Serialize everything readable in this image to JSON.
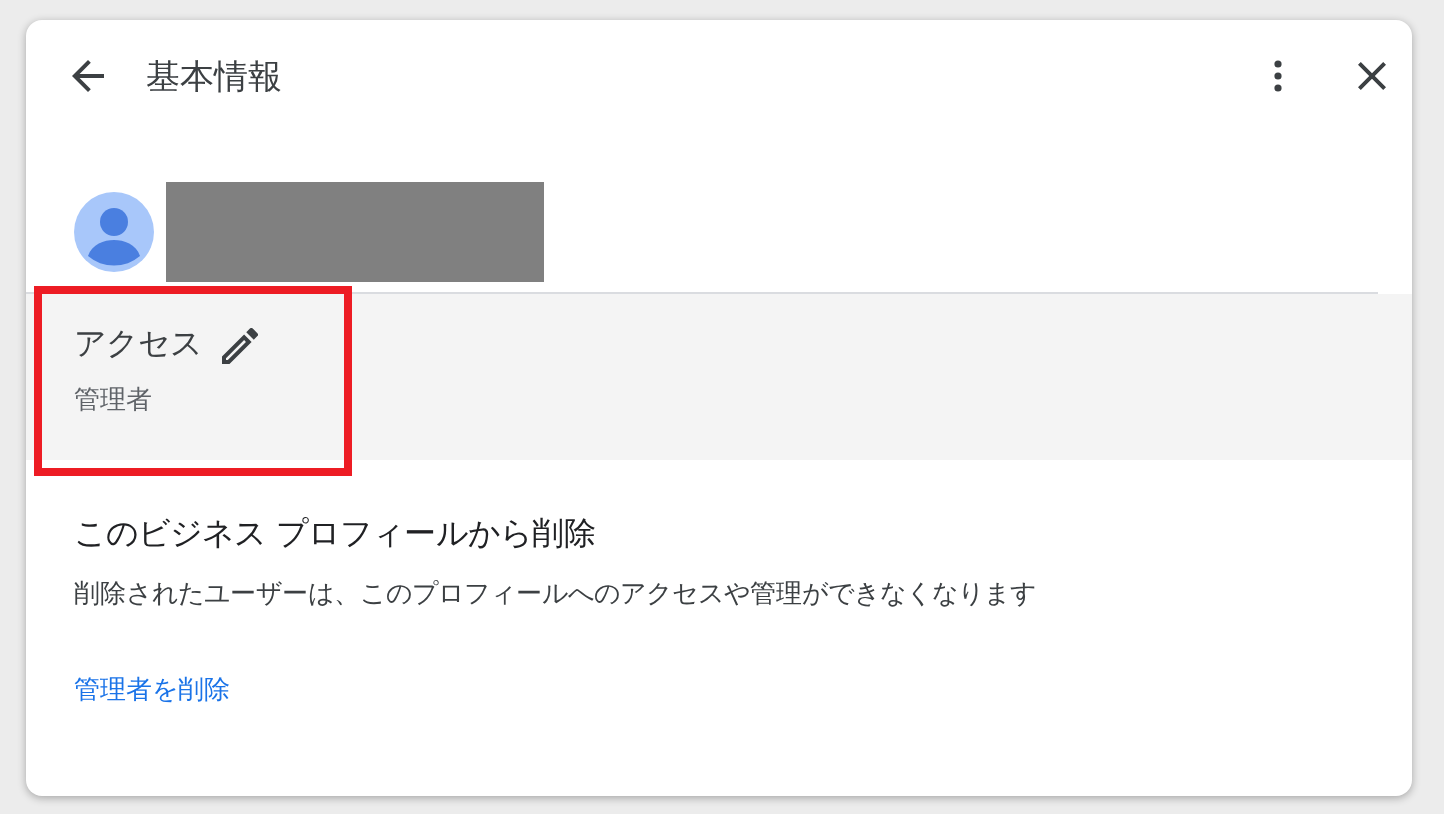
{
  "dialog": {
    "title": "基本情報"
  },
  "access": {
    "label": "アクセス",
    "value": "管理者"
  },
  "remove": {
    "heading": "このビジネス プロフィールから削除",
    "description": "削除されたユーザーは、このプロフィールへのアクセスや管理ができなくなります",
    "link": "管理者を削除"
  }
}
